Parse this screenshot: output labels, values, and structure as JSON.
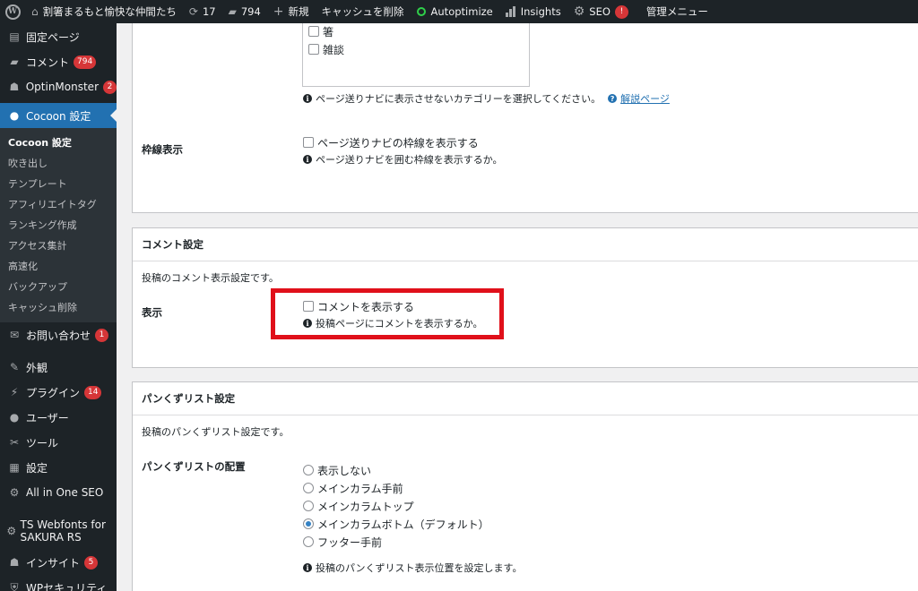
{
  "adminbar": {
    "site_name": "割箸まるもと愉快な仲間たち",
    "updates_count": "17",
    "comments_count": "794",
    "new_label": "新規",
    "cache_clear": "キャッシュを削除",
    "autoptimize": "Autoptimize",
    "insights": "Insights",
    "seo": "SEO",
    "seo_badge": "!",
    "admin_menu": "管理メニュー",
    "colors": {
      "bg": "#1d2327",
      "autoptimize_ring": "#2fd04a"
    }
  },
  "sidebar": {
    "fixed_page": "固定ページ",
    "comments": "コメント",
    "comments_badge": "794",
    "optinmonster": "OptinMonster",
    "optinmonster_badge": "2",
    "cocoon": "Cocoon 設定",
    "submenu": [
      "Cocoon 設定",
      "吹き出し",
      "テンプレート",
      "アフィリエイトタグ",
      "ランキング作成",
      "アクセス集計",
      "高速化",
      "バックアップ",
      "キャッシュ削除"
    ],
    "contact": "お問い合わせ",
    "contact_badge": "1",
    "appearance": "外観",
    "plugins": "プラグイン",
    "plugins_badge": "14",
    "users": "ユーザー",
    "tools": "ツール",
    "settings": "設定",
    "aioseo": "All in One SEO",
    "ts_webfonts": "TS Webfonts for SAKURA RS",
    "insight": "インサイト",
    "insight_badge": "5",
    "wp_security": "WPセキュリティ",
    "colors": {
      "active": "#2271b1",
      "badge": "#d63638"
    }
  },
  "pager": {
    "categories": [
      "箸",
      "雑談"
    ],
    "exclude_hint": "ページ送りナビに表示させないカテゴリーを選択してください。",
    "help_link": "解説ページ",
    "border_label": "枠線表示",
    "border_checkbox": "ページ送りナビの枠線を表示する",
    "border_hint": "ページ送りナビを囲む枠線を表示するか。"
  },
  "comment": {
    "title": "コメント設定",
    "desc": "投稿のコメント表示設定です。",
    "display_label": "表示",
    "display_checkbox": "コメントを表示する",
    "display_hint": "投稿ページにコメントを表示するか。",
    "highlight_color": "#e0101a"
  },
  "breadcrumb": {
    "title": "パンくずリスト設定",
    "desc": "投稿のパンくずリスト設定です。",
    "position_label": "パンくずリストの配置",
    "options": [
      "表示しない",
      "メインカラム手前",
      "メインカラムトップ",
      "メインカラムボトム（デフォルト）",
      "フッター手前"
    ],
    "selected_index": 3,
    "position_hint": "投稿のパンくずリスト表示位置を設定します。"
  }
}
